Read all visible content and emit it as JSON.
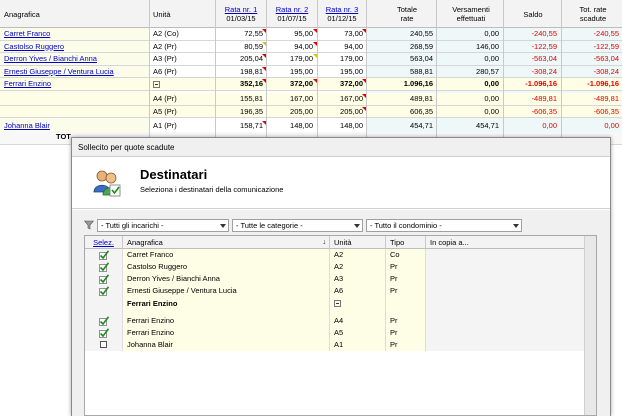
{
  "background_table": {
    "headers": {
      "anagrafica": "Anagrafica",
      "unita": "Unità",
      "rata1_link": "Rata nr. 1",
      "rata1_date": "01/03/15",
      "rata2_link": "Rata nr. 2",
      "rata2_date": "01/07/15",
      "rata3_link": "Rata nr. 3",
      "rata3_date": "01/12/15",
      "totale": "Totale",
      "totale2": "rate",
      "versamenti": "Versamenti",
      "versamenti2": "effettuati",
      "saldo": "Saldo",
      "tot_scadute": "Tot. rate",
      "tot_scadute2": "scadute"
    },
    "rows": [
      {
        "name": "Carret Franco",
        "unit": "A2 (Co)",
        "r1": "72,55",
        "r2": "95,00",
        "r3": "73,00",
        "tot": "240,55",
        "vers": "0,00",
        "saldo": "-240,55",
        "scad": "-240,55"
      },
      {
        "name": "Castolso Ruggero",
        "unit": "A2 (Pr)",
        "r1": "80,59",
        "r2": "94,00",
        "r3": "94,00",
        "tot": "268,59",
        "vers": "146,00",
        "saldo": "-122,59",
        "scad": "-122,59"
      },
      {
        "name": "Derron Yives / Bianchi Anna",
        "unit": "A3 (Pr)",
        "r1": "205,04",
        "r2": "179,00",
        "r3": "179,00",
        "tot": "563,04",
        "vers": "0,00",
        "saldo": "-563,04",
        "scad": "-563,04"
      },
      {
        "name": "Ernesti Giuseppe / Ventura Lucia",
        "unit": "A6 (Pr)",
        "r1": "198,81",
        "r2": "195,00",
        "r3": "195,00",
        "tot": "588,81",
        "vers": "280,57",
        "saldo": "-308,24",
        "scad": "-308,24"
      },
      {
        "name": "Ferrari Enzino",
        "unit": "",
        "r1": "352,16",
        "r2": "372,00",
        "r3": "372,00",
        "tot": "1.096,16",
        "vers": "0,00",
        "saldo": "-1.096,16",
        "scad": "-1.096,16"
      },
      {
        "name": "",
        "unit": "A4 (Pr)",
        "r1": "155,81",
        "r2": "167,00",
        "r3": "167,00",
        "tot": "489,81",
        "vers": "0,00",
        "saldo": "-489,81",
        "scad": "-489,81"
      },
      {
        "name": "",
        "unit": "A5 (Pr)",
        "r1": "196,35",
        "r2": "205,00",
        "r3": "205,00",
        "tot": "606,35",
        "vers": "0,00",
        "saldo": "-606,35",
        "scad": "-606,35"
      },
      {
        "name": "Johanna Blair",
        "unit": "A1 (Pr)",
        "r1": "158,71",
        "r2": "148,00",
        "r3": "148,00",
        "tot": "454,71",
        "vers": "454,71",
        "saldo": "0,00",
        "scad": "0,00"
      }
    ],
    "total_label": "TOT"
  },
  "dialog": {
    "title": "Sollecito per quote scadute",
    "heading": "Destinatari",
    "subheading": "Seleziona i destinatari della comunicazione",
    "filters": {
      "incarichi": "- Tutti gli incarichi -",
      "categorie": "- Tutte le categorie -",
      "condominio": "- Tutto il condominio -"
    },
    "grid_headers": {
      "selez": "Selez.",
      "anagrafica": "Anagrafica",
      "unita": "Unità",
      "tipo": "Tipo",
      "copia": "In copia a..."
    },
    "grid_rows": [
      {
        "checked": true,
        "name": "Carret Franco",
        "unit": "A2",
        "tipo": "Co",
        "group": false
      },
      {
        "checked": true,
        "name": "Castolso Ruggero",
        "unit": "A2",
        "tipo": "Pr",
        "group": false
      },
      {
        "checked": true,
        "name": "Derron Yives / Bianchi Anna",
        "unit": "A3",
        "tipo": "Pr",
        "group": false
      },
      {
        "checked": true,
        "name": "Ernesti Giuseppe / Ventura Lucia",
        "unit": "A6",
        "tipo": "Pr",
        "group": false
      },
      {
        "checked": false,
        "name": "Ferrari Enzino",
        "unit": "",
        "tipo": "",
        "group": true
      },
      {
        "checked": true,
        "name": "Ferrari Enzino",
        "unit": "A4",
        "tipo": "Pr",
        "group": false
      },
      {
        "checked": true,
        "name": "Ferrari Enzino",
        "unit": "A5",
        "tipo": "Pr",
        "group": false
      },
      {
        "checked": false,
        "name": "Johanna Blair",
        "unit": "A1",
        "tipo": "Pr",
        "group": false
      }
    ]
  },
  "colors": {
    "link": "#0000cc",
    "negative": "#e00000",
    "check": "#1f8a1f",
    "group_bg": "#fefee6"
  },
  "icons": {
    "users": "users-icon",
    "filter": "funnel-icon",
    "check": "check-icon",
    "collapse": "minus-box-icon",
    "sort": "sort-arrow-icon"
  }
}
